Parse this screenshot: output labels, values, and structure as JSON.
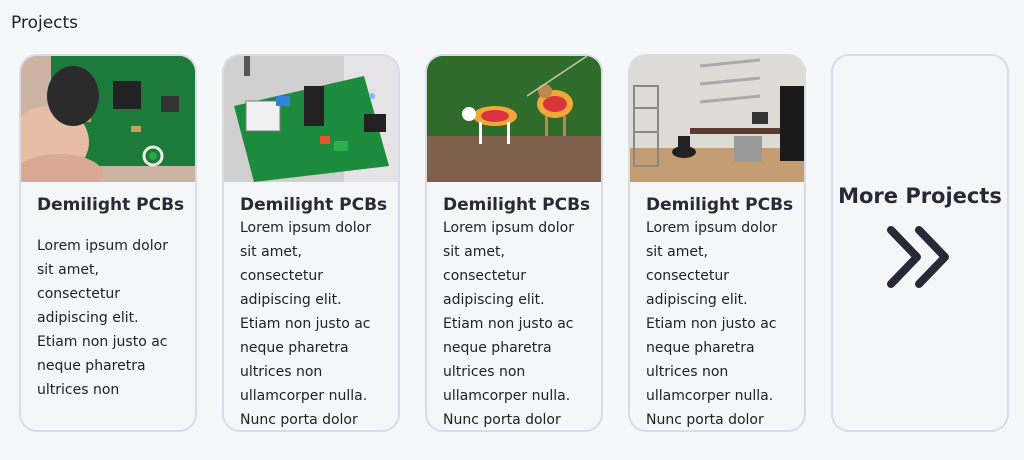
{
  "section": {
    "title": "Projects"
  },
  "cards": [
    {
      "title": "Demilight PCBs",
      "text": "Lorem ipsum dolor sit amet, consectetur adipiscing elit. Etiam non justo ac neque pharetra ultrices non",
      "image": "pcb-closeup-photo"
    },
    {
      "title": "Demilight PCBs",
      "text": "Lorem ipsum dolor sit amet, consectetur adipiscing elit. Etiam non justo ac neque pharetra ultrices non ullamcorper nulla. Nunc porta dolor",
      "image": "pcb-board-photo"
    },
    {
      "title": "Demilight PCBs",
      "text": "Lorem ipsum dolor sit amet, consectetur adipiscing elit. Etiam non justo ac neque pharetra ultrices non ullamcorper nulla. Nunc porta dolor",
      "image": "dogs-costume-photo"
    },
    {
      "title": "Demilight PCBs",
      "text": "Lorem ipsum dolor sit amet, consectetur adipiscing elit. Etiam non justo ac neque pharetra ultrices non ullamcorper nulla. Nunc porta dolor",
      "image": "office-render-photo"
    }
  ],
  "more": {
    "title": "More Projects",
    "icon": "double-chevron-right-icon"
  },
  "colors": {
    "page_bg": "#f6f7f9",
    "card_border": "#d9dce2",
    "text_dark": "#252a36"
  }
}
